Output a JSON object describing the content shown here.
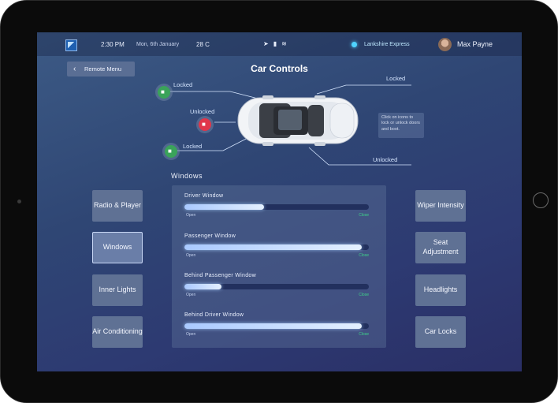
{
  "status_bar": {
    "time": "2:30 PM",
    "date": "Mon, 6th January",
    "temperature": "28 C",
    "route": "Lankshire Express",
    "user_name": "Max Payne"
  },
  "header": {
    "back_label": "Remote Menu",
    "title": "Car Controls"
  },
  "locks": {
    "front_left": "Locked",
    "rear_left": "Unlocked",
    "middle_left": "Locked",
    "front_right": "Locked",
    "rear_right": "Unlocked",
    "hint": "Click on icons to lock or unlock doors and boot."
  },
  "windows": {
    "section_title": "Windows",
    "open_label": "Open",
    "close_label": "Close",
    "items": [
      {
        "name": "Driver Window",
        "level": 0.43
      },
      {
        "name": "Passenger Window",
        "level": 0.96
      },
      {
        "name": "Behind Passenger Window",
        "level": 0.2
      },
      {
        "name": "Behind Driver Window",
        "level": 0.96
      }
    ]
  },
  "left_buttons": [
    "Radio & Player",
    "Windows",
    "Inner Lights",
    "Air Conditioning"
  ],
  "right_buttons": [
    "Wiper Intensity",
    "Seat Adjustment",
    "Headlights",
    "Car Locks"
  ],
  "selected_button": "Windows",
  "colors": {
    "locked": "#3aa35a",
    "unlocked": "#e0364a",
    "close": "#3fd48a",
    "route_dot": "#4fd4ff"
  }
}
